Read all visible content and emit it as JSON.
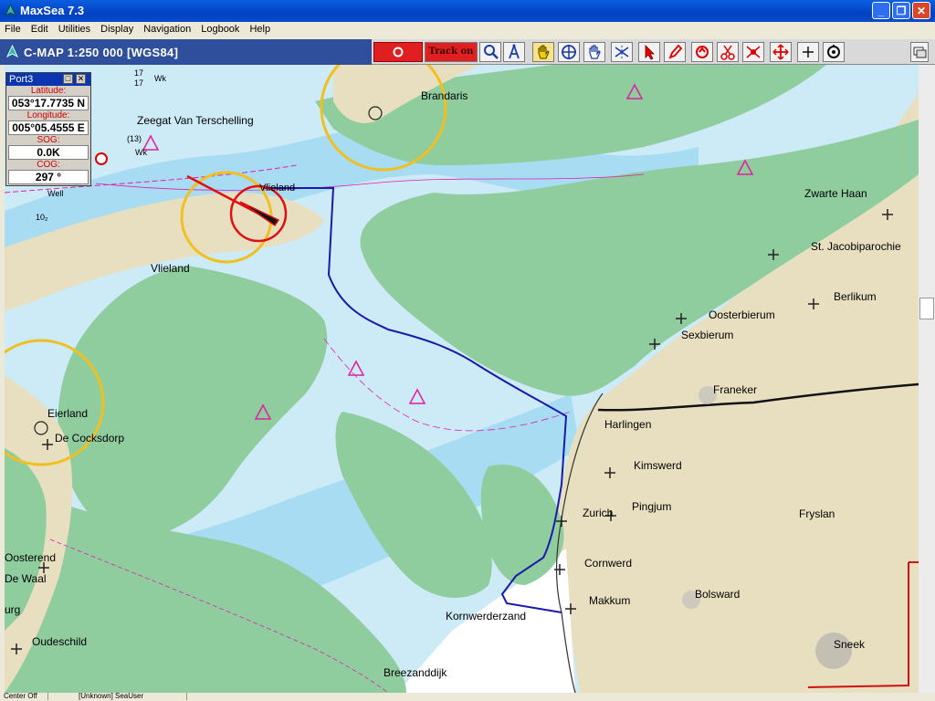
{
  "window": {
    "title": "MaxSea 7.3",
    "minimize": "_",
    "restore": "❐",
    "close": "✕"
  },
  "menu": [
    "File",
    "Edit",
    "Utilities",
    "Display",
    "Navigation",
    "Logbook",
    "Help"
  ],
  "chart": {
    "title": "C-MAP  1:250 000 [WGS84]"
  },
  "toolbar": {
    "track_label": "Track on"
  },
  "panel": {
    "title": "Port3",
    "lat_label": "Latitude:",
    "lat_value": "053°17.7735 N",
    "lon_label": "Longitude:",
    "lon_value": "005°05.4555 E",
    "sog_label": "SOG:",
    "sog_value": "0.0K",
    "cog_label": "COG:",
    "cog_value": "297 °"
  },
  "places": {
    "brandaris": "Brandaris",
    "zeegat": "Zeegat Van Terschelling",
    "vlieland_town": "Vlieland",
    "vlieland": "Vlieland",
    "eierland": "Eierland",
    "cocksdorp": "De Cocksdorp",
    "oosterend": "Oosterend",
    "dewaal": "De Waal",
    "burg": "urg",
    "oudeschild": "Oudeschild",
    "zwarte_haan": "Zwarte Haan",
    "st_jacobi": "St. Jacobiparochie",
    "berlikum": "Berlikum",
    "oosterbierum": "Oosterbierum",
    "sexbierum": "Sexbierum",
    "franeker": "Franeker",
    "harlingen": "Harlingen",
    "kimswerd": "Kimswerd",
    "pingjum": "Pingjum",
    "zurich": "Zurich",
    "fryslan": "Fryslan",
    "cornwerd": "Cornwerd",
    "makkum": "Makkum",
    "bolsward": "Bolsward",
    "sneek": "Sneek",
    "kornwerderzand": "Kornwerderzand",
    "breezanddijk": "Breezanddijk"
  },
  "depths": {
    "d17a": "17",
    "d17b": "17",
    "d13": "(13)",
    "d10": "10₂",
    "wk1": "Wk",
    "wk2": "Wk",
    "well": "Well"
  },
  "status": {
    "left": "Center Off",
    "user": "[Unknown] SeaUser"
  },
  "colors": {
    "sea": "#cdeaf7",
    "deep": "#a8dcf2",
    "land": "#e8dfc0",
    "flat": "#8fcc9e",
    "route": "#1a1aa8"
  }
}
